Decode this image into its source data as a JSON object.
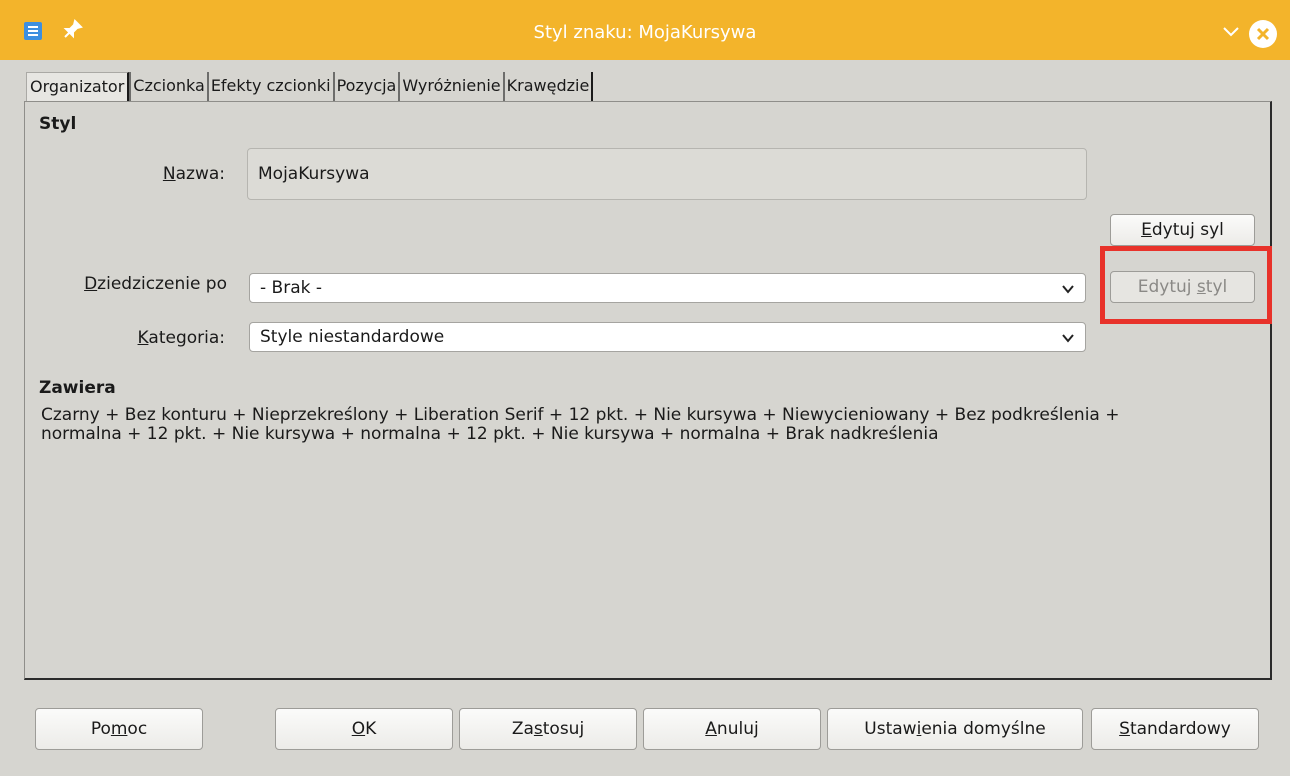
{
  "window": {
    "title": "Styl znaku: MojaKursywa",
    "colors": {
      "titlebar": "#f3b42b",
      "highlight": "#e8322a"
    }
  },
  "tabs": [
    {
      "label": "Organizator",
      "active": true
    },
    {
      "label": "Czcionka"
    },
    {
      "label": "Efekty czcionki"
    },
    {
      "label": "Pozycja"
    },
    {
      "label": "Wyróżnienie"
    },
    {
      "label": "Krawędzie"
    }
  ],
  "style_section": {
    "heading": "Styl",
    "name_label_pre": "",
    "name_label_u": "N",
    "name_label_post": "azwa:",
    "name_value": "MojaKursywa",
    "edit_style_button_1_pre": "",
    "edit_style_button_1_u": "E",
    "edit_style_button_1_post": "dytuj syl",
    "inherit_label_pre": "",
    "inherit_label_u": "D",
    "inherit_label_post": "ziedziczenie po",
    "inherit_value": "- Brak -",
    "edit_style_button_2_pre": "Edytuj ",
    "edit_style_button_2_u": "s",
    "edit_style_button_2_post": "tyl",
    "category_label_pre": "",
    "category_label_u": "K",
    "category_label_post": "ategoria:",
    "category_value": "Style niestandardowe"
  },
  "contains_section": {
    "heading": "Zawiera",
    "text": "Czarny + Bez konturu + Nieprzekreślony + Liberation Serif + 12 pkt. + Nie kursywa + Niewycieniowany + Bez podkreślenia + normalna + 12 pkt. + Nie kursywa + normalna + 12 pkt. + Nie kursywa + normalna + Brak nadkreślenia"
  },
  "buttons": {
    "help_pre": "Po",
    "help_u": "m",
    "help_post": "oc",
    "ok_pre": "",
    "ok_u": "O",
    "ok_post": "K",
    "apply_pre": "Za",
    "apply_u": "s",
    "apply_post": "tosuj",
    "cancel_pre": "",
    "cancel_u": "A",
    "cancel_post": "nuluj",
    "defaults_pre": "Ustaw",
    "defaults_u": "i",
    "defaults_post": "enia domyślne",
    "standard_pre": "",
    "standard_u": "S",
    "standard_post": "tandardowy"
  }
}
